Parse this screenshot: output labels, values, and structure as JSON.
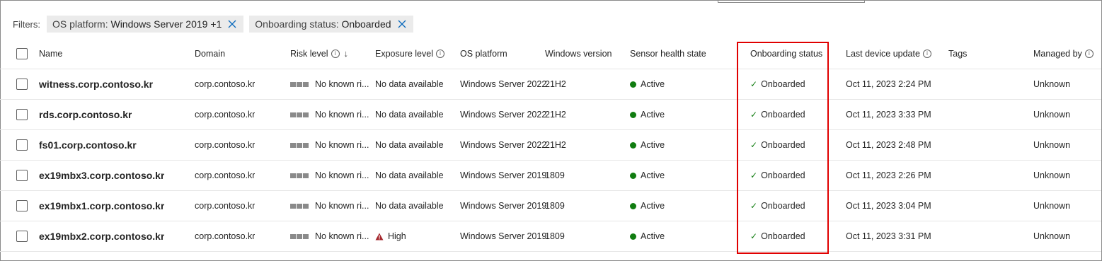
{
  "filters": {
    "label": "Filters:",
    "pills": [
      {
        "key": "OS platform:",
        "value": "Windows Server 2019 +1"
      },
      {
        "key": "Onboarding status:",
        "value": "Onboarded"
      }
    ]
  },
  "columns": {
    "name": "Name",
    "domain": "Domain",
    "risk": "Risk level",
    "exposure": "Exposure level",
    "os": "OS platform",
    "winver": "Windows version",
    "sensor": "Sensor health state",
    "onboarding": "Onboarding status",
    "lastupdate": "Last device update",
    "tags": "Tags",
    "managed": "Managed by"
  },
  "rows": [
    {
      "name": "witness.corp.contoso.kr",
      "domain": "corp.contoso.kr",
      "risk": "No known ri...",
      "exposure": "No data available",
      "exposure_high": false,
      "os": "Windows Server 2022",
      "winver": "21H2",
      "sensor": "Active",
      "onboarding": "Onboarded",
      "lastupdate": "Oct 11, 2023 2:24 PM",
      "tags": "",
      "managed": "Unknown"
    },
    {
      "name": "rds.corp.contoso.kr",
      "domain": "corp.contoso.kr",
      "risk": "No known ri...",
      "exposure": "No data available",
      "exposure_high": false,
      "os": "Windows Server 2022",
      "winver": "21H2",
      "sensor": "Active",
      "onboarding": "Onboarded",
      "lastupdate": "Oct 11, 2023 3:33 PM",
      "tags": "",
      "managed": "Unknown"
    },
    {
      "name": "fs01.corp.contoso.kr",
      "domain": "corp.contoso.kr",
      "risk": "No known ri...",
      "exposure": "No data available",
      "exposure_high": false,
      "os": "Windows Server 2022",
      "winver": "21H2",
      "sensor": "Active",
      "onboarding": "Onboarded",
      "lastupdate": "Oct 11, 2023 2:48 PM",
      "tags": "",
      "managed": "Unknown"
    },
    {
      "name": "ex19mbx3.corp.contoso.kr",
      "domain": "corp.contoso.kr",
      "risk": "No known ri...",
      "exposure": "No data available",
      "exposure_high": false,
      "os": "Windows Server 2019",
      "winver": "1809",
      "sensor": "Active",
      "onboarding": "Onboarded",
      "lastupdate": "Oct 11, 2023 2:26 PM",
      "tags": "",
      "managed": "Unknown"
    },
    {
      "name": "ex19mbx1.corp.contoso.kr",
      "domain": "corp.contoso.kr",
      "risk": "No known ri...",
      "exposure": "No data available",
      "exposure_high": false,
      "os": "Windows Server 2019",
      "winver": "1809",
      "sensor": "Active",
      "onboarding": "Onboarded",
      "lastupdate": "Oct 11, 2023 3:04 PM",
      "tags": "",
      "managed": "Unknown"
    },
    {
      "name": "ex19mbx2.corp.contoso.kr",
      "domain": "corp.contoso.kr",
      "risk": "No known ri...",
      "exposure": "High",
      "exposure_high": true,
      "os": "Windows Server 2019",
      "winver": "1809",
      "sensor": "Active",
      "onboarding": "Onboarded",
      "lastupdate": "Oct 11, 2023 3:31 PM",
      "tags": "",
      "managed": "Unknown"
    }
  ],
  "icons": {
    "remove_filter": "close-icon",
    "info": "info-icon",
    "sort": "arrow-down-icon",
    "risk": "risk-bars-icon",
    "sensor": "status-dot-icon",
    "onboarding": "checkmark-icon",
    "exposure_high": "warning-icon"
  },
  "colors": {
    "accent": "#0f6cbd",
    "active": "#107c10",
    "high": "#a4262c",
    "highlight_box": "#e00000"
  }
}
